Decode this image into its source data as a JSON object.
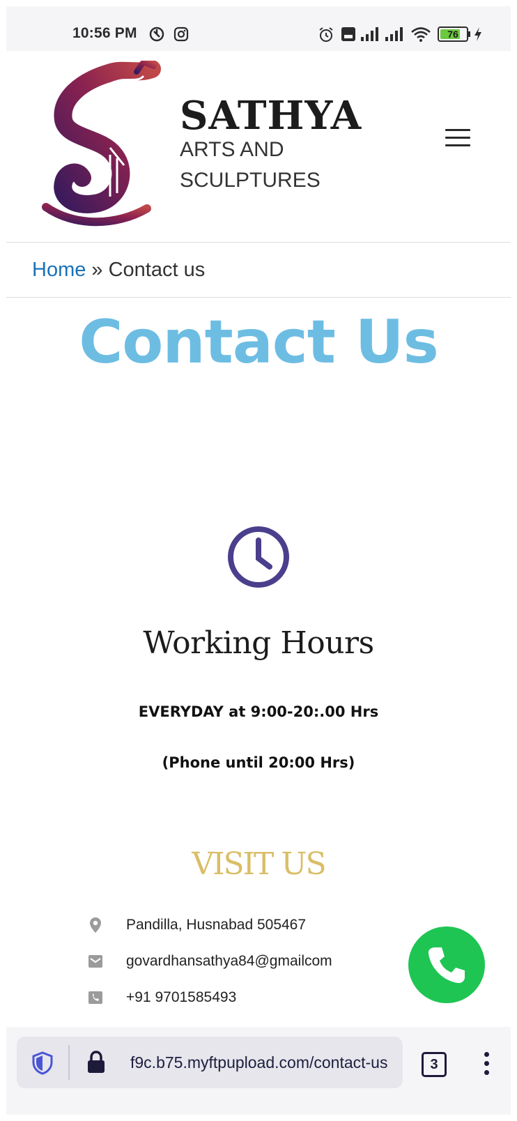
{
  "status_bar": {
    "time": "10:56 PM",
    "battery": "76"
  },
  "header": {
    "brand_name": "SATHYA",
    "brand_sub": "ARTS AND SCULPTURES"
  },
  "breadcrumb": {
    "home": "Home",
    "separator": " » ",
    "current": "Contact us"
  },
  "page": {
    "title": "Contact Us"
  },
  "working_hours": {
    "title": "Working Hours",
    "line1": "EVERYDAY at 9:00-20:.00 Hrs",
    "line2": "(Phone until 20:00 Hrs)"
  },
  "visit": {
    "title": "VISIT US",
    "address": "Pandilla, Husnabad 505467",
    "email": "govardhansathya84@gmailcom",
    "phone": "+91 9701585493"
  },
  "browser": {
    "url": "f9c.b75.myftpupload.com/contact-us",
    "tab_count": "3"
  },
  "colors": {
    "title_blue": "#6dbde3",
    "link_blue": "#1a72b8",
    "gold": "#d9be67",
    "clock_purple": "#4a3f8c",
    "fab_green": "#1ec553"
  },
  "icons": {
    "status": [
      "vpn-icon",
      "instagram-icon",
      "alarm-icon",
      "volte-icon",
      "signal-icon",
      "signal-icon",
      "wifi-icon",
      "battery-icon",
      "charging-icon"
    ],
    "contact": [
      "location-pin-icon",
      "envelope-icon",
      "phone-square-icon"
    ]
  }
}
